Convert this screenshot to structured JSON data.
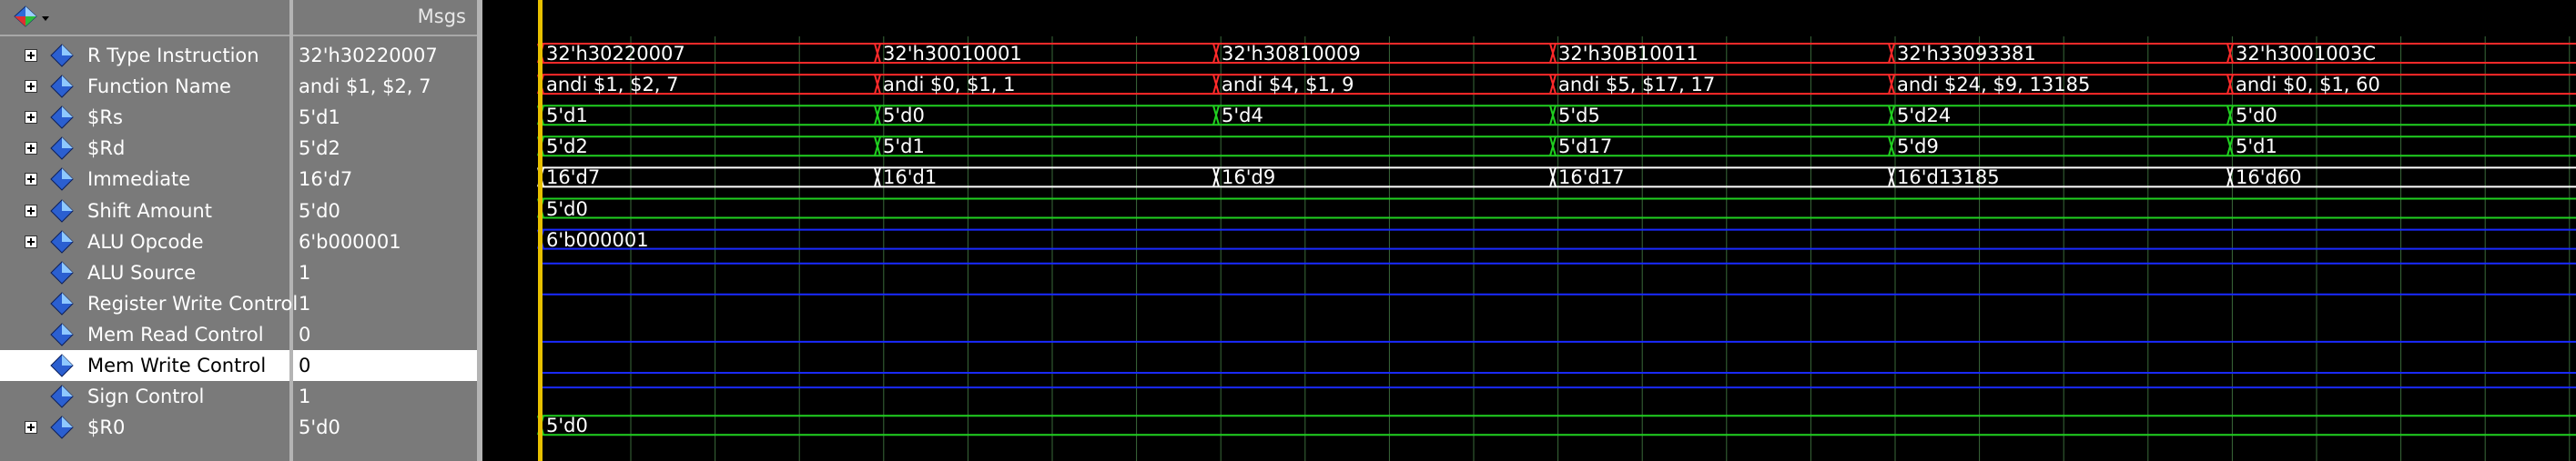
{
  "toolbar": {
    "msgs_label": "Msgs"
  },
  "signals": [
    {
      "name": "R Type Instruction",
      "value": "32'h30220007",
      "expandable": true,
      "segments": [
        "32'h30220007",
        "32'h30010001",
        "32'h30810009",
        "32'h30B10011",
        "32'h33093381",
        "32'h3001003C"
      ]
    },
    {
      "name": "Function Name",
      "value": "andi $1, $2, 7",
      "expandable": true,
      "segments": [
        "andi $1, $2, 7",
        "andi $0, $1, 1",
        "andi $4, $1, 9",
        "andi $5, $17, 17",
        "andi $24, $9, 13185",
        "andi $0, $1, 60"
      ]
    },
    {
      "name": "$Rs",
      "value": "5'd1",
      "expandable": true,
      "segments": [
        "5'd1",
        "5'd0",
        "5'd4",
        "5'd5",
        "5'd24",
        "5'd0"
      ]
    },
    {
      "name": "$Rd",
      "value": "5'd2",
      "expandable": true,
      "segments": [
        "5'd2",
        "5'd1",
        "",
        "5'd17",
        "5'd9",
        "5'd1"
      ]
    },
    {
      "name": "Immediate",
      "value": "16'd7",
      "expandable": true,
      "segments": [
        "16'd7",
        "16'd1",
        "16'd9",
        "16'd17",
        "16'd13185",
        "16'd60"
      ]
    },
    {
      "name": "Shift Amount",
      "value": "5'd0",
      "expandable": true,
      "segments": [
        "5'd0",
        "",
        "",
        "",
        "",
        ""
      ]
    },
    {
      "name": "ALU Opcode",
      "value": "6'b000001",
      "expandable": true,
      "segments": [
        "6'b000001",
        "",
        "",
        "",
        "",
        ""
      ]
    },
    {
      "name": "ALU Source",
      "value": "1",
      "expandable": false,
      "segments": []
    },
    {
      "name": "Register Write Control",
      "value": "1",
      "expandable": false,
      "segments": []
    },
    {
      "name": "Mem Read Control",
      "value": "0",
      "expandable": false,
      "segments": []
    },
    {
      "name": "Mem Write Control",
      "value": "0",
      "expandable": false,
      "selected": true,
      "segments": []
    },
    {
      "name": "Sign Control",
      "value": "1",
      "expandable": false,
      "segments": []
    },
    {
      "name": "$R0",
      "value": "5'd0",
      "expandable": true,
      "segments": [
        "5'd0",
        "",
        "",
        "",
        "",
        ""
      ]
    }
  ],
  "colors": {
    "bus_red": "#ff2a2a",
    "bus_green": "#20d020",
    "bus_white": "#ffffff",
    "bit_blue": "#1a2aff",
    "cursor": "#e8c000",
    "grid": "#3a6a3a"
  }
}
